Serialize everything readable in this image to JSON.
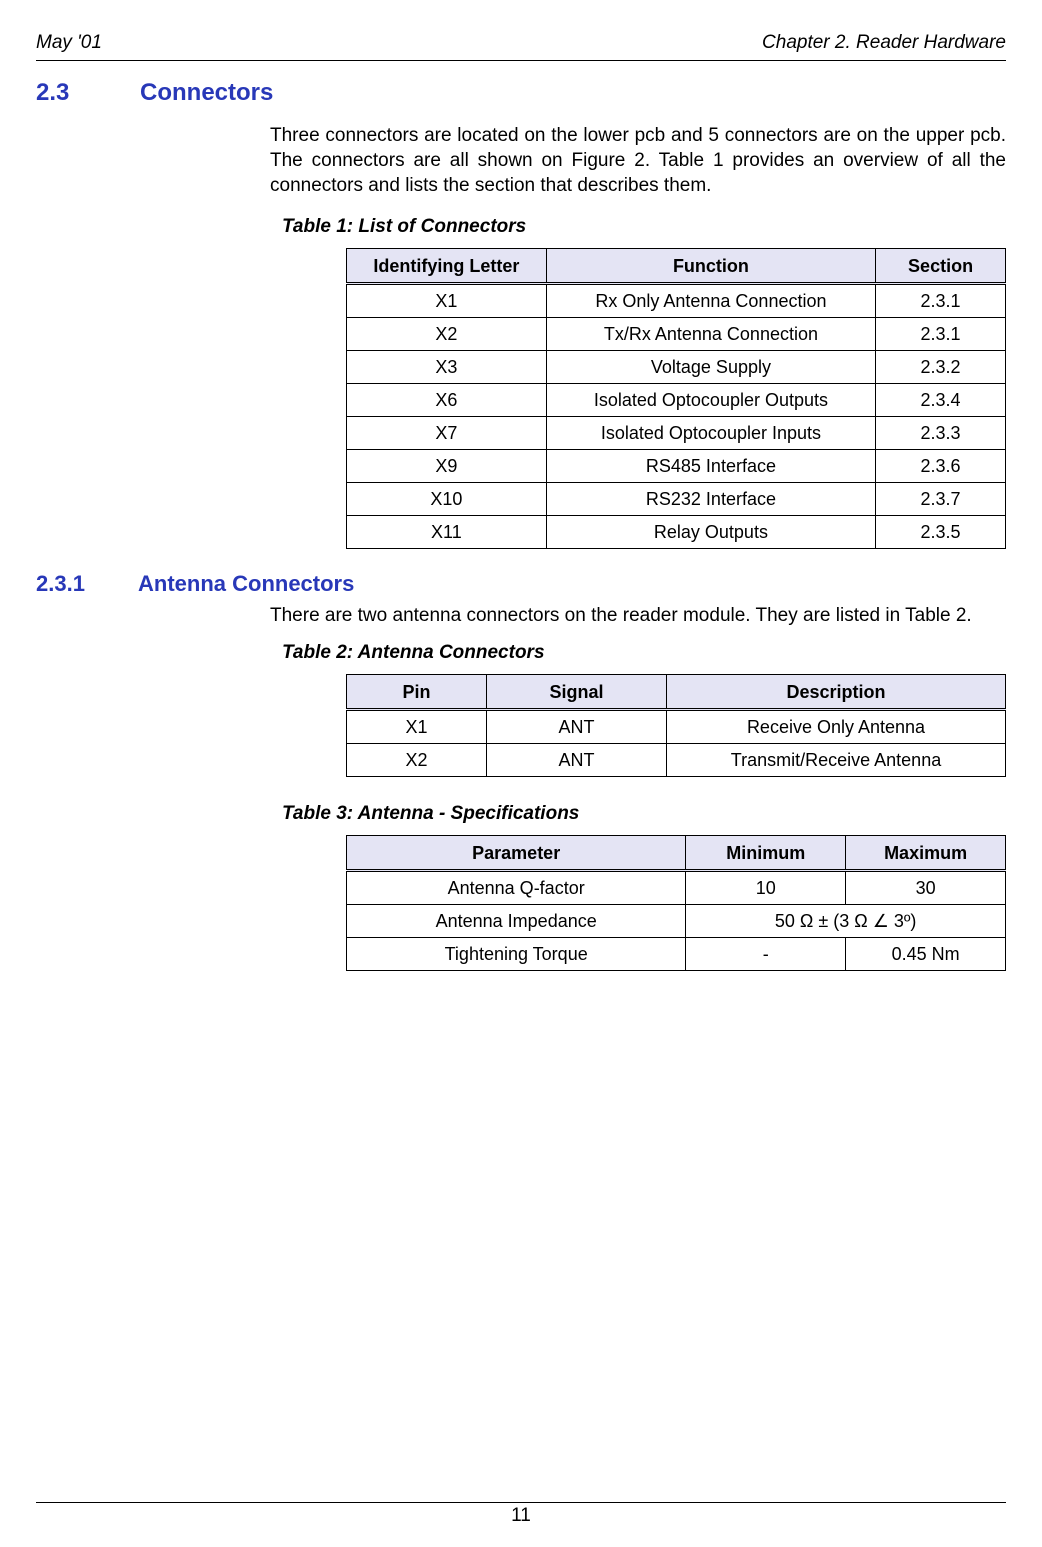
{
  "header": {
    "left": "May '01",
    "right": "Chapter 2. Reader Hardware"
  },
  "section": {
    "num": "2.3",
    "title": "Connectors",
    "intro": "Three connectors are located on the lower pcb and 5 connectors are on the upper pcb. The connectors are all shown on Figure 2. Table 1 provides an overview of all the connectors and lists the section that describes them."
  },
  "table1": {
    "caption": "Table 1: List of Connectors",
    "headers": [
      "Identifying Letter",
      "Function",
      "Section"
    ],
    "rows": [
      [
        "X1",
        "Rx Only Antenna Connection",
        "2.3.1"
      ],
      [
        "X2",
        "Tx/Rx Antenna Connection",
        "2.3.1"
      ],
      [
        "X3",
        "Voltage Supply",
        "2.3.2"
      ],
      [
        "X6",
        "Isolated Optocoupler Outputs",
        "2.3.4"
      ],
      [
        "X7",
        "Isolated Optocoupler Inputs",
        "2.3.3"
      ],
      [
        "X9",
        "RS485 Interface",
        "2.3.6"
      ],
      [
        "X10",
        "RS232 Interface",
        "2.3.7"
      ],
      [
        "X11",
        "Relay Outputs",
        "2.3.5"
      ]
    ]
  },
  "subsection": {
    "num": "2.3.1",
    "title": "Antenna Connectors",
    "intro": "There are two antenna connectors on the reader module. They are listed in Table 2."
  },
  "table2": {
    "caption": "Table 2: Antenna Connectors",
    "headers": [
      "Pin",
      "Signal",
      "Description"
    ],
    "rows": [
      [
        "X1",
        "ANT",
        "Receive Only Antenna"
      ],
      [
        "X2",
        "ANT",
        "Transmit/Receive Antenna"
      ]
    ]
  },
  "table3": {
    "caption": "Table 3: Antenna - Specifications",
    "headers": [
      "Parameter",
      "Minimum",
      "Maximum"
    ],
    "rows": [
      {
        "cells": [
          "Antenna Q-factor",
          "10",
          "30"
        ],
        "span": false
      },
      {
        "cells": [
          "Antenna Impedance",
          "50 Ω ± (3 Ω ∠ 3º)"
        ],
        "span": true
      },
      {
        "cells": [
          "Tightening Torque",
          "-",
          "0.45 Nm"
        ],
        "span": false
      }
    ]
  },
  "footer": {
    "page": "11"
  }
}
